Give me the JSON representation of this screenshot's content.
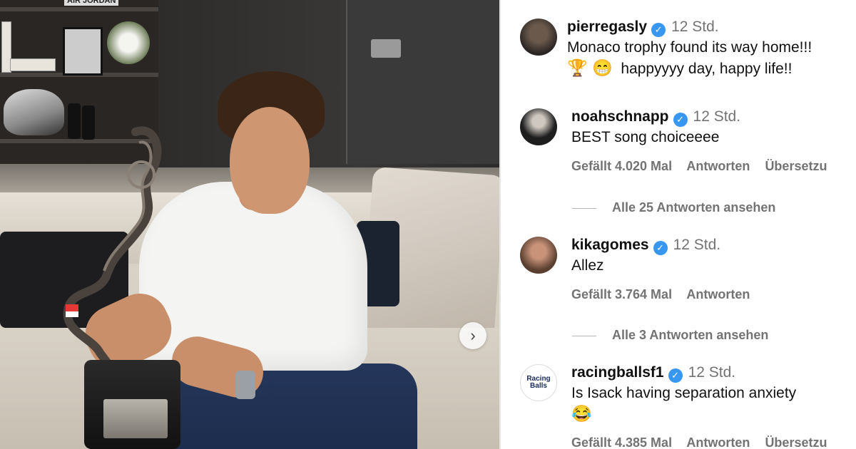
{
  "post": {
    "author": "pierregasly",
    "time": "12 Std.",
    "caption_line1": "Monaco trophy found its way home!!!",
    "caption_line2": "happyyyy day, happy life!!",
    "caption_emoji": "🏆 😁",
    "carousel_next": "›"
  },
  "comments": [
    {
      "username": "noahschnapp",
      "time": "12 Std.",
      "text": "BEST song choiceeee",
      "likes": "Gefällt 4.020 Mal",
      "reply": "Antworten",
      "translate": "Übersetzu",
      "view_replies": "Alle 25 Antworten ansehen"
    },
    {
      "username": "kikagomes",
      "time": "12 Std.",
      "text": "Allez",
      "likes": "Gefällt 3.764 Mal",
      "reply": "Antworten",
      "view_replies": "Alle 3 Antworten ansehen"
    },
    {
      "username": "racingballsf1",
      "time": "12 Std.",
      "text": "Is Isack having separation anxiety",
      "emoji": "😂",
      "likes": "Gefällt 4.385 Mal",
      "reply": "Antworten",
      "translate": "Übersetzu"
    }
  ],
  "shelf_label": "AIR JORDAN",
  "avatar_logo": "Racing Balls",
  "icons": {
    "verified": "verified-badge-icon",
    "like": "heart-outline-icon",
    "carousel": "chevron-right-icon"
  },
  "colors": {
    "verified": "#3897f0",
    "muted": "#737373",
    "text": "#111111"
  }
}
